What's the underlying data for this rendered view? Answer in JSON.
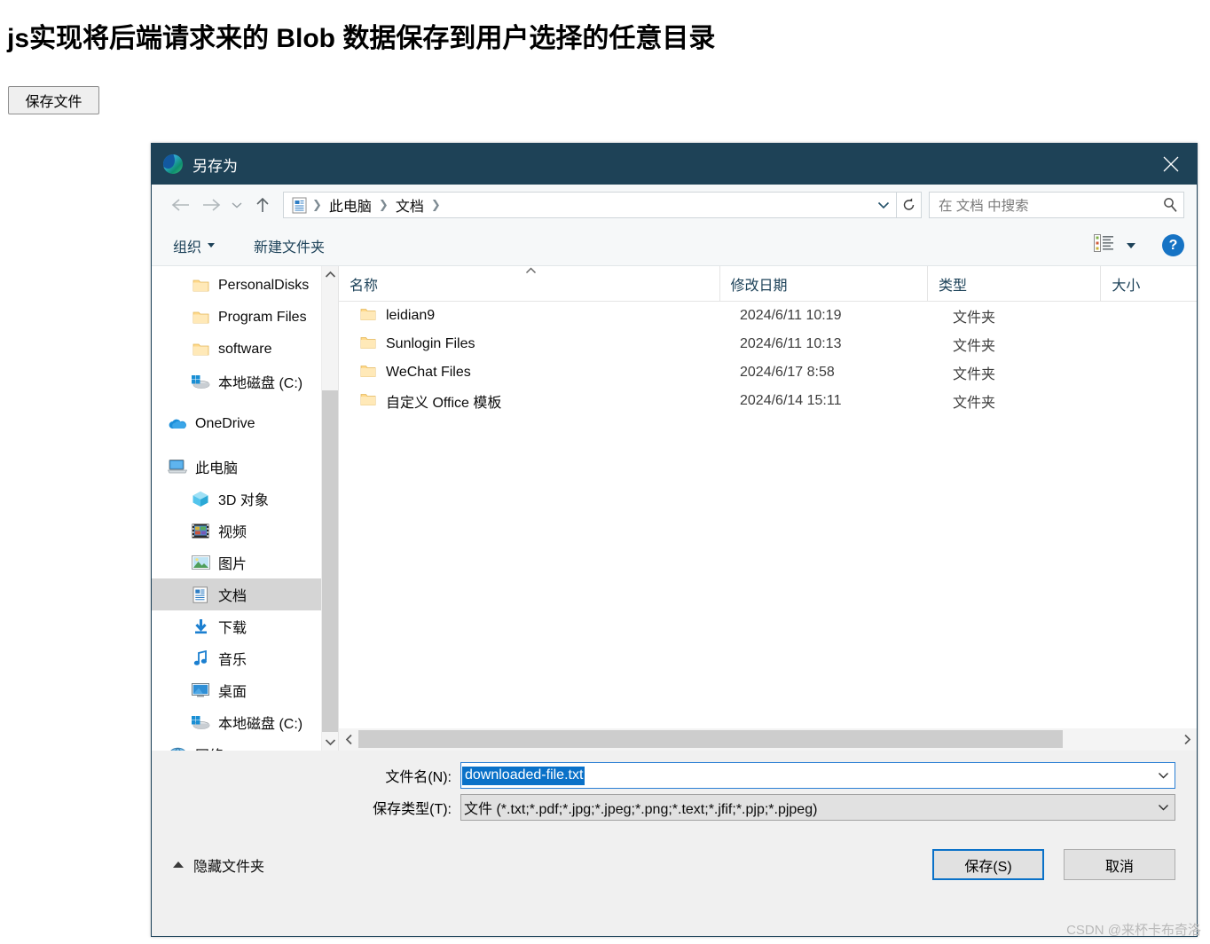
{
  "page": {
    "title": "js实现将后端请求来的 Blob 数据保存到用户选择的任意目录",
    "save_button_label": "保存文件"
  },
  "dialog": {
    "title": "另存为",
    "app_icon": "edge-logo-icon",
    "close_icon": "close-icon",
    "nav": {
      "back_icon": "back-arrow-icon",
      "forward_icon": "forward-arrow-icon",
      "recent_icon": "chevron-down-icon",
      "up_icon": "up-arrow-icon",
      "address_icon": "documents-folder-icon",
      "breadcrumbs": [
        "此电脑",
        "文档"
      ],
      "breadcrumb_separator": "❯",
      "address_dropdown_icon": "chevron-down-icon",
      "refresh_icon": "refresh-icon",
      "search_placeholder": "在 文档 中搜索",
      "search_icon": "search-icon"
    },
    "commandbar": {
      "organize_label": "组织",
      "new_folder_label": "新建文件夹",
      "view_mode_icon": "list-view-icon",
      "view_mode_caret_icon": "chevron-down-icon",
      "help_label": "?",
      "help_icon": "help-icon"
    },
    "sidebar": {
      "items": [
        {
          "label": "PersonalDisks",
          "icon": "folder-icon",
          "indent": 1,
          "selected": false
        },
        {
          "label": "Program Files",
          "icon": "folder-icon",
          "indent": 1,
          "selected": false
        },
        {
          "label": "software",
          "icon": "folder-icon",
          "indent": 1,
          "selected": false
        },
        {
          "label": "本地磁盘 (C:)",
          "icon": "local-disk-icon",
          "indent": 1,
          "selected": false
        },
        {
          "label": "OneDrive",
          "icon": "onedrive-cloud-icon",
          "indent": 0,
          "selected": false
        },
        {
          "label": "此电脑",
          "icon": "this-pc-icon",
          "indent": 0,
          "selected": false
        },
        {
          "label": "3D 对象",
          "icon": "3d-objects-icon",
          "indent": 1,
          "selected": false
        },
        {
          "label": "视频",
          "icon": "videos-icon",
          "indent": 1,
          "selected": false
        },
        {
          "label": "图片",
          "icon": "pictures-icon",
          "indent": 1,
          "selected": false
        },
        {
          "label": "文档",
          "icon": "documents-icon",
          "indent": 1,
          "selected": true
        },
        {
          "label": "下载",
          "icon": "downloads-icon",
          "indent": 1,
          "selected": false
        },
        {
          "label": "音乐",
          "icon": "music-icon",
          "indent": 1,
          "selected": false
        },
        {
          "label": "桌面",
          "icon": "desktop-icon",
          "indent": 1,
          "selected": false
        },
        {
          "label": "本地磁盘 (C:)",
          "icon": "local-disk-icon",
          "indent": 1,
          "selected": false
        },
        {
          "label": "网络",
          "icon": "network-icon",
          "indent": 0,
          "selected": false
        }
      ],
      "scroll_up_icon": "chevron-up-icon",
      "scroll_down_icon": "chevron-down-icon"
    },
    "filelist": {
      "columns": [
        "名称",
        "修改日期",
        "类型",
        "大小"
      ],
      "sort_indicator": "▲",
      "rows": [
        {
          "name": "leidian9",
          "date": "2024/6/11 10:19",
          "type": "文件夹",
          "size": "",
          "icon": "folder-icon"
        },
        {
          "name": "Sunlogin Files",
          "date": "2024/6/11 10:13",
          "type": "文件夹",
          "size": "",
          "icon": "folder-icon"
        },
        {
          "name": "WeChat Files",
          "date": "2024/6/17 8:58",
          "type": "文件夹",
          "size": "",
          "icon": "folder-icon"
        },
        {
          "name": "自定义 Office 模板",
          "date": "2024/6/14 15:11",
          "type": "文件夹",
          "size": "",
          "icon": "folder-icon"
        }
      ],
      "hscroll_left_icon": "chevron-left-icon",
      "hscroll_right_icon": "chevron-right-icon"
    },
    "form": {
      "filename_label": "文件名(N):",
      "filename_value": "downloaded-file.txt",
      "filetype_label": "保存类型(T):",
      "filetype_value": "文件 (*.txt;*.pdf;*.jpg;*.jpeg;*.png;*.text;*.jfif;*.pjp;*.pjpeg)",
      "dropdown_icon": "chevron-down-icon"
    },
    "footer": {
      "hide_folders_label": "隐藏文件夹",
      "hide_folders_icon": "chevron-up-icon",
      "save_label": "保存(S)",
      "cancel_label": "取消"
    }
  },
  "watermark": "CSDN @来杯卡布奇洛",
  "colors": {
    "titlebar_bg": "#1e4257",
    "accent_blue": "#0a71c8",
    "selection_blue": "#0a71c8",
    "sidebar_selected": "#d5d5d5",
    "dialog_bg": "#f0f0f0"
  }
}
